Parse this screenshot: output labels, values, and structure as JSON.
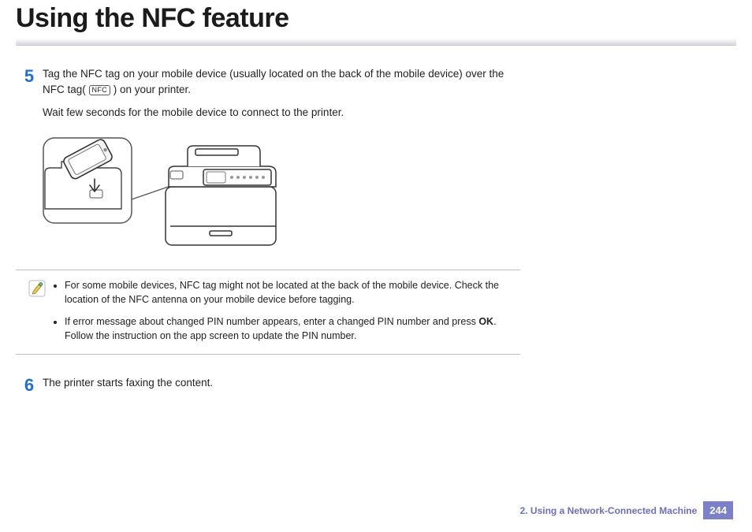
{
  "title": "Using the NFC feature",
  "steps": {
    "s5": {
      "num": "5",
      "p1a": "Tag the NFC tag on your mobile device (usually located on the back of the mobile device) over the NFC tag(",
      "nfc_label": "NFC",
      "p1b": ") on your printer.",
      "p2": "Wait few seconds for the mobile device to connect to the printer."
    },
    "s6": {
      "num": "6",
      "p1": "The printer starts faxing the content."
    }
  },
  "note": {
    "b1": "For some mobile devices, NFC tag might not be located at the back of the mobile device. Check the location of the NFC antenna on your mobile device before tagging.",
    "b2a": "If error message about changed PIN number appears, enter a changed PIN number and press ",
    "ok": "OK",
    "b2b": ". Follow the instruction on the app screen to update the PIN number."
  },
  "footer": {
    "chapter": "2.  Using a Network-Connected Machine",
    "page": "244"
  }
}
